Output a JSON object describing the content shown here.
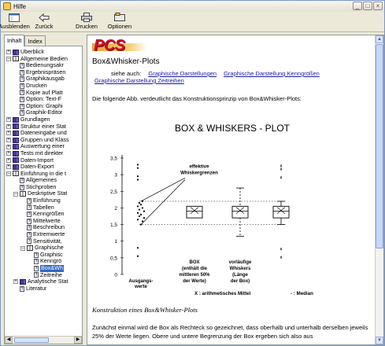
{
  "window": {
    "title": "Hilfe"
  },
  "toolbar": {
    "hide_label": "Ausblenden",
    "back_label": "Zurück",
    "print_label": "Drucken",
    "options_label": "Optionen"
  },
  "tabs": [
    {
      "label": "Inhalt"
    },
    {
      "label": "Index"
    }
  ],
  "tree": [
    {
      "label": "Überblick",
      "kind": "book",
      "indent": 0,
      "expander": "+"
    },
    {
      "label": "Allgemeine Bedien",
      "kind": "book-open",
      "indent": 0,
      "expander": "−"
    },
    {
      "label": "Bedienungsakr",
      "kind": "page",
      "indent": 1
    },
    {
      "label": "Ergebnispräsen",
      "kind": "page",
      "indent": 1
    },
    {
      "label": "Graphikausgab",
      "kind": "page",
      "indent": 1
    },
    {
      "label": "Drucken",
      "kind": "page",
      "indent": 1
    },
    {
      "label": "Kopie auf Platt",
      "kind": "page",
      "indent": 1
    },
    {
      "label": "Option: Text-F",
      "kind": "page",
      "indent": 1
    },
    {
      "label": "Option: Graphi",
      "kind": "page",
      "indent": 1
    },
    {
      "label": "Graphik-Editor",
      "kind": "page",
      "indent": 1
    },
    {
      "label": "Grundlagen",
      "kind": "book",
      "indent": 0,
      "expander": "+"
    },
    {
      "label": "Struktur einer Stat",
      "kind": "book",
      "indent": 0,
      "expander": "+"
    },
    {
      "label": "Dateneingabe und",
      "kind": "book",
      "indent": 0,
      "expander": "+"
    },
    {
      "label": "Gruppen und Klass",
      "kind": "book",
      "indent": 0,
      "expander": "+"
    },
    {
      "label": "Auswertung einer",
      "kind": "book",
      "indent": 0,
      "expander": "+"
    },
    {
      "label": "Tests mit direkter",
      "kind": "book",
      "indent": 0,
      "expander": "+"
    },
    {
      "label": "Daten-Import",
      "kind": "book",
      "indent": 0,
      "expander": "+"
    },
    {
      "label": "Daten-Export",
      "kind": "book",
      "indent": 0,
      "expander": "+"
    },
    {
      "label": "Einführung in die t",
      "kind": "book-open",
      "indent": 0,
      "expander": "−"
    },
    {
      "label": "Allgemeines",
      "kind": "page",
      "indent": 1
    },
    {
      "label": "Stichproben",
      "kind": "page",
      "indent": 1
    },
    {
      "label": "Deskriptive Stat",
      "kind": "book-open",
      "indent": 1,
      "expander": "−"
    },
    {
      "label": "Einführung",
      "kind": "page",
      "indent": 2
    },
    {
      "label": "Tabellen",
      "kind": "page",
      "indent": 2
    },
    {
      "label": "Kenngrößen",
      "kind": "page",
      "indent": 2
    },
    {
      "label": "Mittelwerte",
      "kind": "page",
      "indent": 2
    },
    {
      "label": "Beschreibun",
      "kind": "page",
      "indent": 2
    },
    {
      "label": "Extremwerte",
      "kind": "page",
      "indent": 2
    },
    {
      "label": "Sensitivität,",
      "kind": "page",
      "indent": 2
    },
    {
      "label": "Graphische",
      "kind": "book-open",
      "indent": 2,
      "expander": "−"
    },
    {
      "label": "Graphisc",
      "kind": "page",
      "indent": 3
    },
    {
      "label": "Kenngrö",
      "kind": "page",
      "indent": 3
    },
    {
      "label": "Box&Wh",
      "kind": "page",
      "indent": 3,
      "selected": true
    },
    {
      "label": "Zeitreihe",
      "kind": "page",
      "indent": 3
    },
    {
      "label": "Analytische Stat",
      "kind": "book",
      "indent": 1,
      "expander": "+"
    },
    {
      "label": "Literatur",
      "kind": "page",
      "indent": 1
    }
  ],
  "content": {
    "logo": "PCS",
    "heading": "Box&Whisker-Plots",
    "see_also_prefix": "siehe auch:",
    "see_also_links": [
      "Graphische Darstellungen",
      "Graphische Darstellung Kenngrößen",
      "Graphische Darstellung Zeitreihen"
    ],
    "intro": "Die folgende Abb. verdeutlicht das Konstruktionsprinzip von Box&Whisker-Plots:",
    "subheading": "Konstruktion eines Box&Whisker-Plots",
    "paragraph": "Zunächst einmal wird die Box als Rechteck so gezeichnet, dass oberhalb und unterhalb derselben jeweils 25% der Werte liegen. Obere und untere Begrenzung der Box ergeben sich also aus"
  },
  "chart_data": {
    "type": "boxplot",
    "title": "BOX & WHISKERS - PLOT",
    "ylim": [
      0,
      3.5
    ],
    "yticks": [
      "3,5",
      "3",
      "2,5",
      "2",
      "1,5",
      "1",
      "0,5",
      "0"
    ],
    "annotations": {
      "effective": "effektive Whiskergrenzen",
      "raw_label": "Ausgangs-werte",
      "box_label": "BOX (enthält die mittleren 50% der Werte)",
      "whisker_label": "vorläufige Whiskers (Länge der Box)",
      "mean_legend": "X : arithmetisches Mittel",
      "median_legend": "- : Median"
    },
    "raw_values": [
      3.3,
      3.2,
      2.95,
      2.85,
      2.2,
      2.15,
      2.1,
      2.05,
      2.0,
      1.95,
      1.9,
      1.85,
      1.8,
      1.75,
      1.7,
      1.65,
      1.6,
      1.5,
      0.8,
      0.55
    ],
    "boxes": [
      {
        "name": "BOX",
        "q1": 1.7,
        "q3": 2.05,
        "median": 1.9,
        "mean": 1.9
      },
      {
        "name": "vorläufige Whiskers",
        "q1": 1.7,
        "q3": 2.05,
        "median": 1.9,
        "mean": 1.9,
        "whisker_low": 1.15,
        "whisker_high": 2.6
      },
      {
        "name": "effektive Whiskers",
        "q1": 1.7,
        "q3": 2.05,
        "median": 1.9,
        "mean": 1.9,
        "whisker_low": 1.5,
        "whisker_high": 2.2
      }
    ],
    "outliers": [
      3.3,
      3.2,
      2.95,
      0.8,
      0.55
    ],
    "guides": [
      2.2,
      1.5
    ]
  }
}
